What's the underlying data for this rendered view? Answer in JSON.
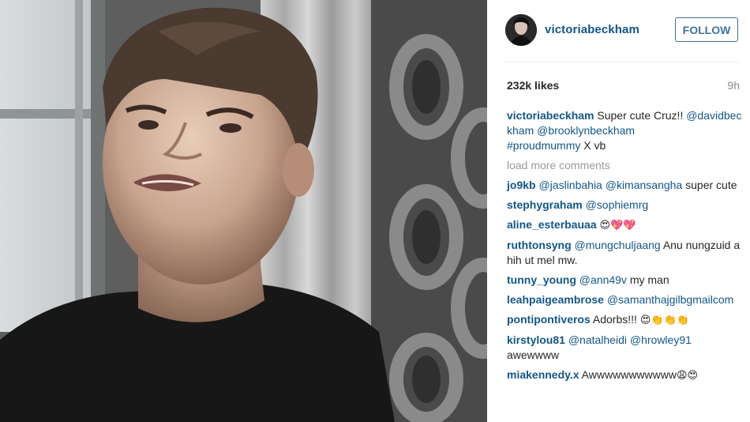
{
  "post": {
    "username": "victoriabeckham",
    "follow_label": "FOLLOW",
    "likes": "232k likes",
    "time_ago": "9h",
    "load_more": "load more comments"
  },
  "caption": {
    "user": "victoriabeckham",
    "text1": " Super cute Cruz!! ",
    "mention1": "@davidbeckham",
    "space": " ",
    "mention2": "@brooklynbeckham",
    "hashtag": "#proudmummy",
    "text2": " X vb"
  },
  "comments": [
    {
      "user": "jo9kb",
      "parts": [
        " ",
        "@jaslinbahia",
        " ",
        "@kimansangha",
        " super cute"
      ]
    },
    {
      "user": "stephygraham",
      "parts": [
        " ",
        "@sophiemrg"
      ]
    },
    {
      "user": "aline_esterbauaa",
      "parts": [
        " ",
        "😍💖💖"
      ]
    },
    {
      "user": "ruthtonsyng",
      "parts": [
        " ",
        "@mungchuljaang",
        " Anu nungzuid ahih ut mel mw."
      ]
    },
    {
      "user": "tunny_young",
      "parts": [
        " ",
        "@ann49v",
        " my man"
      ]
    },
    {
      "user": "leahpaigeambrose",
      "parts": [
        " ",
        "@samanthajgilbgmailcom"
      ]
    },
    {
      "user": "pontipontiveros",
      "parts": [
        " Adorbs!!! ",
        "😍👏👏👏"
      ]
    },
    {
      "user": "kirstylou81",
      "parts": [
        " ",
        "@natalheidi",
        " ",
        "@hrowley91",
        " awewwww"
      ]
    },
    {
      "user": "miakennedy.x",
      "parts": [
        " Awwwwwwwwwww",
        "😩😍"
      ]
    }
  ],
  "colors": {
    "link": "#125688",
    "follow": "#3f729b",
    "muted": "#999999"
  },
  "icons": {
    "avatar": "profile-photo"
  }
}
